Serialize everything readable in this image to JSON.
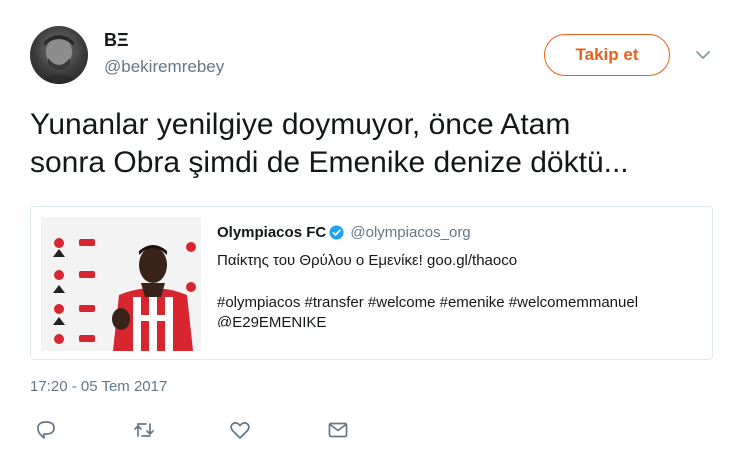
{
  "author": {
    "display_name": "BΞ",
    "handle": "@bekiremrebey",
    "avatar_icon": "avatar-photo"
  },
  "follow_button": {
    "label": "Takip et"
  },
  "tweet": {
    "lines": [
      "Yunanlar yenilgiye doymuyor, önce Atam",
      "sonra Obra şimdi de Emenike denize döktü..."
    ],
    "timestamp": "17:20 - 05 Tem 2017"
  },
  "quoted_tweet": {
    "name": "Olympiacos FC",
    "handle": "@olympiacos_org",
    "line1": "Παίκτης του Θρύλου ο Εμενίκε! goo.gl/thaoco",
    "line2": "#olympiacos #transfer #welcome #emenike #welcomemmanuel",
    "line3": "@E29EMENIKE",
    "media_icon": "player-photo"
  },
  "actions": [
    "reply-icon",
    "retweet-icon",
    "like-icon",
    "message-icon"
  ],
  "colors": {
    "accent": "#e8601e",
    "secondary_text": "#657786",
    "verified": "#1da1f2",
    "jersey_red": "#d7262f"
  }
}
